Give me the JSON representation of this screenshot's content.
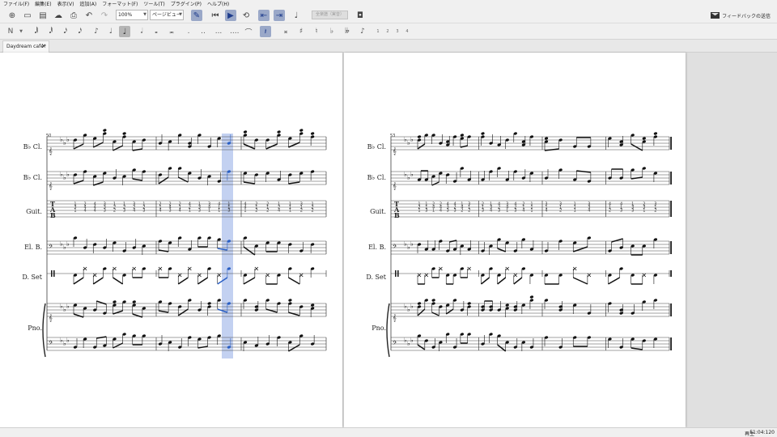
{
  "menu": [
    "ファイル(F)",
    "編集(E)",
    "表示(V)",
    "追加(A)",
    "フォーマット(F)",
    "ツール(T)",
    "プラグイン(P)",
    "ヘルプ(H)"
  ],
  "toolbar": {
    "zoom_value": "100%",
    "view_mode": "ページビュー",
    "concert_pitch_label": "全楽譜（実音）",
    "feedback_label": "フィードバックの送信"
  },
  "note_input": {
    "voice_labels": [
      "1",
      "2",
      "3",
      "4"
    ]
  },
  "tab": {
    "title": "Daydream café*",
    "close": "×"
  },
  "score": {
    "system1_measure_number": "50",
    "system2_measure_number": "53",
    "instruments": [
      "B♭ Cl.",
      "B♭ Cl.",
      "Guit.",
      "El. B.",
      "D. Set",
      "Pno."
    ],
    "tab_letters": [
      "T",
      "A",
      "B"
    ],
    "selection_color": "#b8c9ee",
    "note_highlight_color": "#2a5fc4"
  },
  "status": {
    "mode": "再生",
    "time": "51:04:120"
  }
}
